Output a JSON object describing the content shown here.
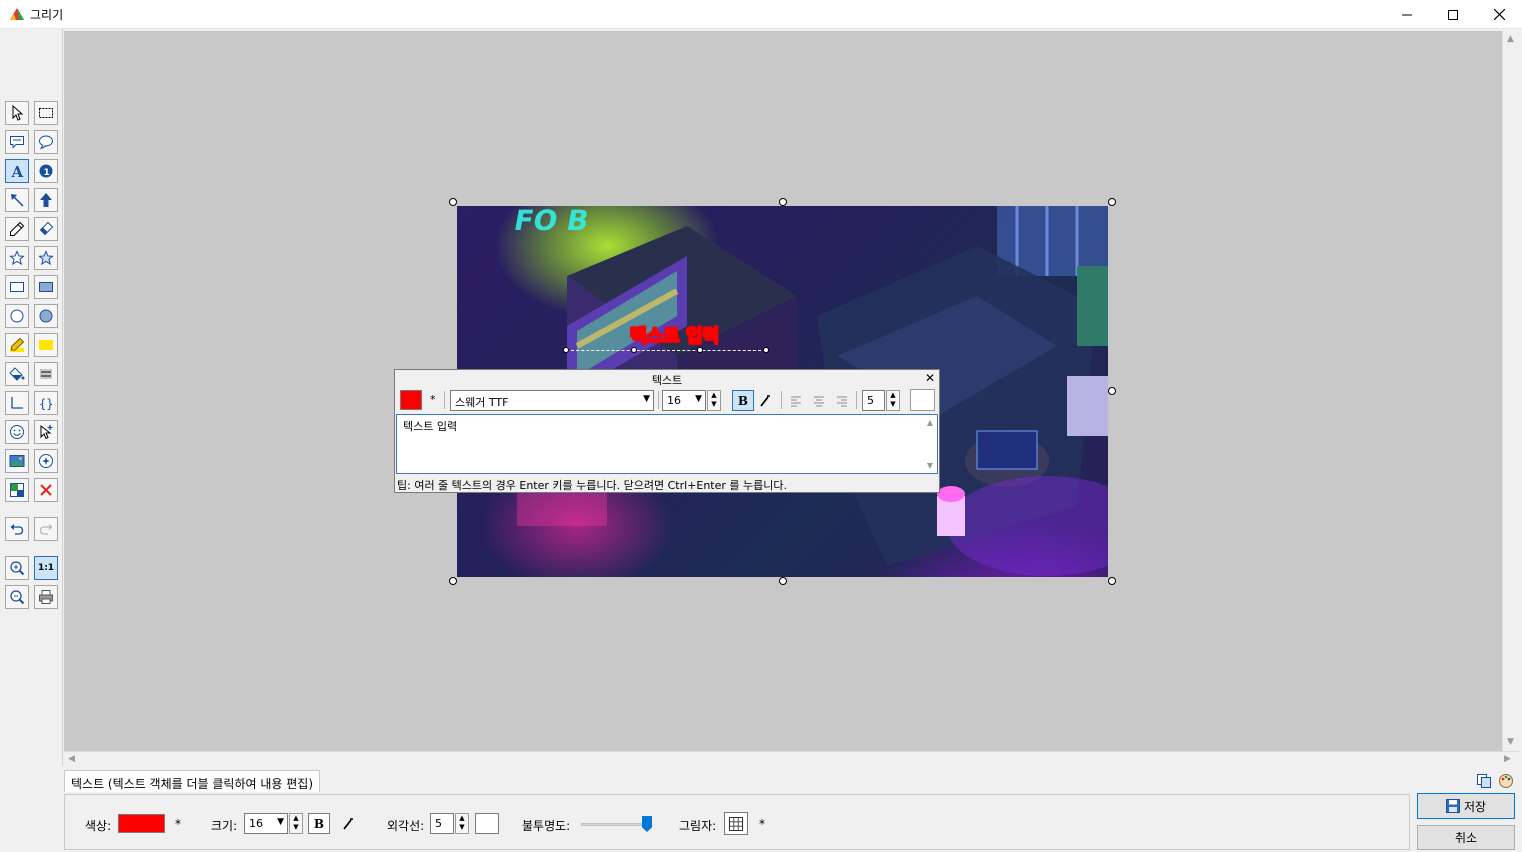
{
  "window": {
    "title": "그리기",
    "app_icon": "paint-palette-icon",
    "controls": [
      "minimize-icon",
      "maximize-icon",
      "close-icon"
    ]
  },
  "text_object": {
    "content": "텍스트 입력",
    "fill_color": "#ffffff",
    "outline_color": "#ff0000"
  },
  "text_dialog": {
    "title": "텍스트",
    "color": "#ff0000",
    "color_star": "*",
    "font": "스웨거 TTF",
    "size": "16",
    "outline_width": "5",
    "text": "텍스트 입력",
    "tip": "팁: 여러 줄 텍스트의 경우 Enter 키를 누릅니다. 닫으려면 Ctrl+Enter 를 누릅니다."
  },
  "properties": {
    "tab_label": "텍스트 (텍스트 객체를 더블 클릭하여 내용 편집)",
    "color_label": "색상:",
    "color_value": "#ff0000",
    "color_star": "*",
    "size_label": "크기:",
    "size_value": "16",
    "outline_label": "외각선:",
    "outline_value": "5",
    "opacity_label": "불투명도:",
    "opacity_value": 1.0,
    "shadow_label": "그림자:",
    "shadow_star": "*"
  },
  "buttons": {
    "save": "저장",
    "cancel": "취소"
  },
  "zoom_label": "1:1"
}
